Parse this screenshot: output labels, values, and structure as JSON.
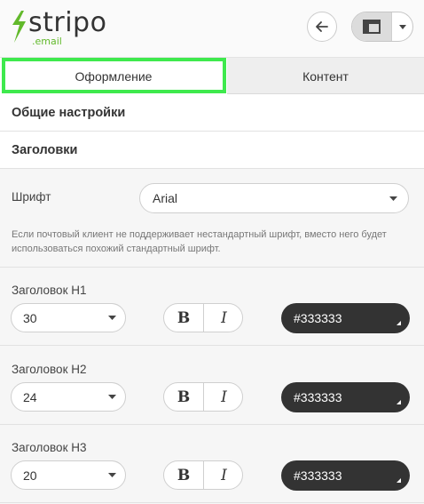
{
  "logo": {
    "name": "stripo",
    "sub": ".email",
    "brand_color": "#62b92b"
  },
  "tabs": [
    {
      "label": "Оформление",
      "active": true,
      "highlight_color": "#3ee94d"
    },
    {
      "label": "Контент",
      "active": false
    }
  ],
  "sections": {
    "general": "Общие настройки",
    "headings": "Заголовки"
  },
  "font": {
    "label": "Шрифт",
    "value": "Arial",
    "note": "Если почтовый клиент не поддерживает нестандартный шрифт, вместо него будет использоваться похожий стандартный шрифт."
  },
  "headings": [
    {
      "label": "Заголовок H1",
      "size": "30",
      "bold": "B",
      "italic": "I",
      "color": "#333333"
    },
    {
      "label": "Заголовок H2",
      "size": "24",
      "bold": "B",
      "italic": "I",
      "color": "#333333"
    },
    {
      "label": "Заголовок H3",
      "size": "20",
      "bold": "B",
      "italic": "I",
      "color": "#333333"
    }
  ],
  "icons": [
    "stripo-logo-icon",
    "arrow-left-icon",
    "layout-panel-icon",
    "caret-down-icon"
  ]
}
